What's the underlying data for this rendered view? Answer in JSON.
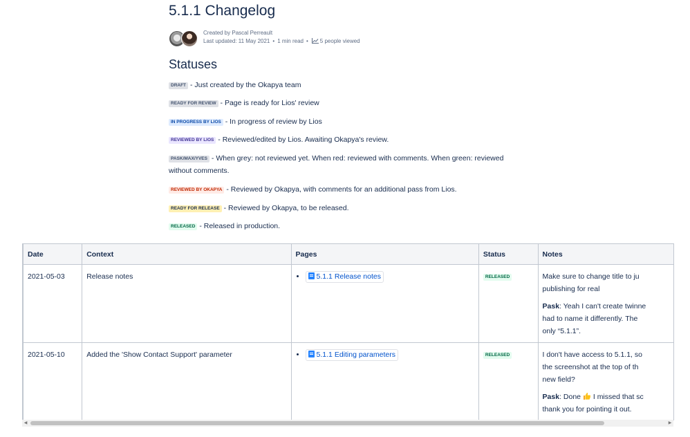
{
  "page": {
    "title": "5.1.1 Changelog",
    "byline": {
      "created": "Created by Pascal Perreault",
      "updated": "Last updated: 11 May 2021",
      "read_time": "1 min read",
      "views": "5 people viewed"
    }
  },
  "statuses": {
    "heading": "Statuses",
    "items": [
      {
        "badge": "DRAFT",
        "color": "grey",
        "text": " - Just created by the Okapya team"
      },
      {
        "badge": "READY FOR REVIEW",
        "color": "grey",
        "text": " - Page is ready for Lios' review"
      },
      {
        "badge": "IN PROGRESS BY LIOS",
        "color": "blue",
        "text": " - In progress of review by Lios"
      },
      {
        "badge": "REVIEWED BY LIOS",
        "color": "purple",
        "text": " - Reviewed/edited by Lios. Awaiting Okapya's review."
      },
      {
        "badge": "PASK/MAX/YVES",
        "color": "grey",
        "text": " - When grey: not reviewed yet. When red: reviewed with comments. When green: reviewed without comments."
      },
      {
        "badge": "REVIEWED BY OKAPYA",
        "color": "red",
        "text": " - Reviewed by Okapya, with comments for an additional pass from Lios."
      },
      {
        "badge": "READY FOR RELEASE",
        "color": "yellow",
        "text": " - Reviewed by Okapya, to be released."
      },
      {
        "badge": "RELEASED",
        "color": "green",
        "text": " - Released in production."
      }
    ]
  },
  "table": {
    "headers": {
      "date": "Date",
      "context": "Context",
      "pages": "Pages",
      "status": "Status",
      "notes": "Notes"
    },
    "rows": [
      {
        "date": "2021-05-03",
        "context": "Release notes",
        "page_link": "5.1.1 Release notes",
        "status": "RELEASED",
        "note_1": "Make sure to change title to ju",
        "note_1b": "publishing for real",
        "note_2_author": "Pask",
        "note_2": ": Yeah I can't create twinne",
        "note_2b": "had to name it differently. The",
        "note_2c": "only “5.1.1”."
      },
      {
        "date": "2021-05-10",
        "context": "Added the 'Show Contact Support' parameter",
        "page_link": "5.1.1 Editing parameters",
        "status": "RELEASED",
        "note_1": "I don't have access to 5.1.1, so",
        "note_1b": "the screenshot at the top of th",
        "note_1c": "new field?",
        "note_2_author": "Pask",
        "note_2": ": Done",
        "note_2_after": " I missed that sc",
        "note_2b": "thank you for pointing it out."
      }
    ]
  },
  "colors": {
    "text": "#172b4d",
    "link": "#0052cc",
    "border": "#c1c7d0",
    "header_bg": "#f4f5f7",
    "released_bg": "#e3fcef",
    "released_fg": "#006644"
  }
}
